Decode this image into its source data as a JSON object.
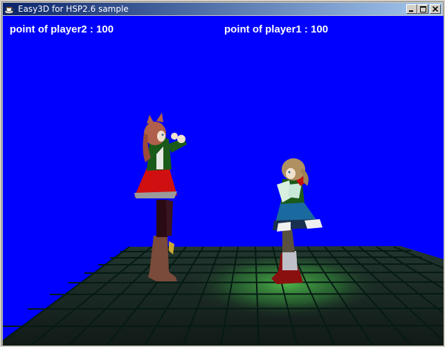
{
  "window": {
    "title": "Easy3D for HSP2.6 sample",
    "icon": "teacup-app-icon",
    "controls": [
      "minimize",
      "maximize",
      "close"
    ]
  },
  "hud": {
    "player2_score": "point of player2 : 100",
    "player1_score": "point of player1 : 100"
  },
  "scene": {
    "background_color": "#0000ff",
    "floor_color": "#1a2a24",
    "grid_line_color": "#062018",
    "spotlight_color": "#3a9a3a"
  }
}
